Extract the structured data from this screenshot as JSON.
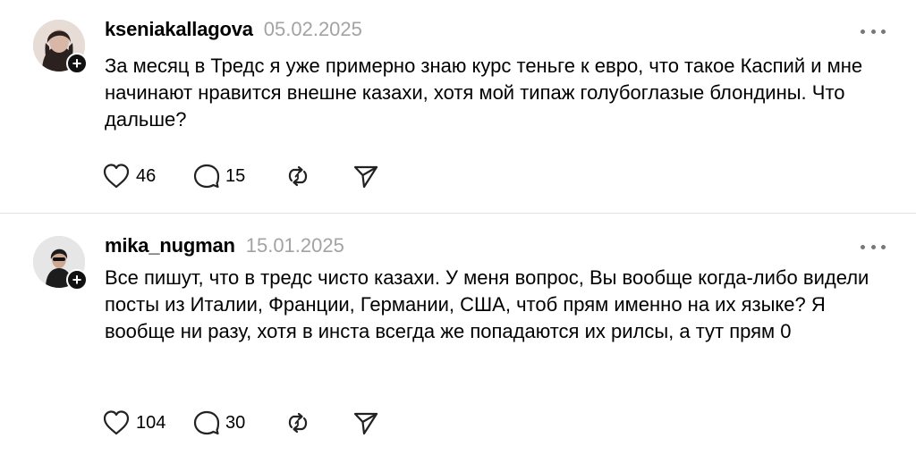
{
  "posts": [
    {
      "username": "kseniakallagova",
      "date": "05.02.2025",
      "text": "За месяц в Тредс я уже примерно знаю курс теньге к евро, что такое Каспий и мне начинают нравится внешне казахи, хотя мой типаж голубоглазые блондины. Что дальше?",
      "likes": "46",
      "replies": "15",
      "follow_symbol": "+"
    },
    {
      "username": "mika_nugman",
      "date": "15.01.2025",
      "text": "Все пишут, что в тредс чисто казахи. У меня вопрос, Вы вообще когда-либо видели посты из Италии, Франции, Германии, США, чтоб прям именно на их языке? Я вообще ни разу, хотя в инста всегда же попадаются их рилсы, а тут прям 0",
      "likes": "104",
      "replies": "30",
      "follow_symbol": "+"
    }
  ],
  "icons": {
    "like": "heart-icon",
    "reply": "comment-bubble-icon",
    "repost": "repost-icon",
    "share": "send-icon",
    "more": "more-dots-icon",
    "follow": "plus-icon"
  },
  "colors": {
    "date": "#a3a3a3",
    "divider": "#e1e1e1",
    "follow_badge": "#111111"
  }
}
